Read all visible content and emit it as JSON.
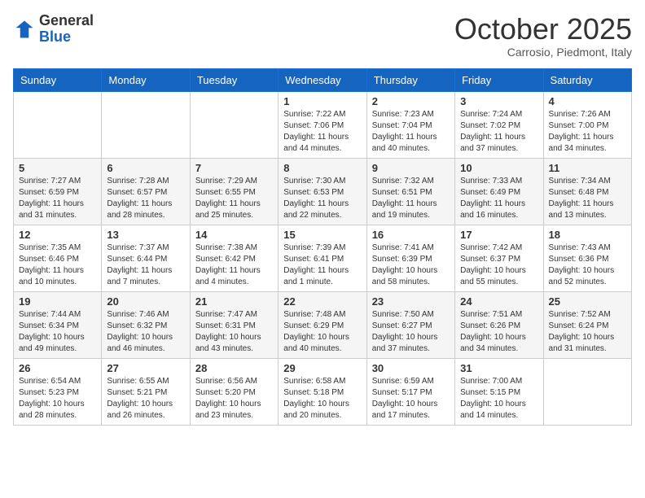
{
  "header": {
    "logo": {
      "general": "General",
      "blue": "Blue"
    },
    "title": "October 2025",
    "location": "Carrosio, Piedmont, Italy"
  },
  "weekdays": [
    "Sunday",
    "Monday",
    "Tuesday",
    "Wednesday",
    "Thursday",
    "Friday",
    "Saturday"
  ],
  "weeks": [
    [
      {
        "day": "",
        "sunrise": "",
        "sunset": "",
        "daylight": ""
      },
      {
        "day": "",
        "sunrise": "",
        "sunset": "",
        "daylight": ""
      },
      {
        "day": "",
        "sunrise": "",
        "sunset": "",
        "daylight": ""
      },
      {
        "day": "1",
        "sunrise": "Sunrise: 7:22 AM",
        "sunset": "Sunset: 7:06 PM",
        "daylight": "Daylight: 11 hours and 44 minutes."
      },
      {
        "day": "2",
        "sunrise": "Sunrise: 7:23 AM",
        "sunset": "Sunset: 7:04 PM",
        "daylight": "Daylight: 11 hours and 40 minutes."
      },
      {
        "day": "3",
        "sunrise": "Sunrise: 7:24 AM",
        "sunset": "Sunset: 7:02 PM",
        "daylight": "Daylight: 11 hours and 37 minutes."
      },
      {
        "day": "4",
        "sunrise": "Sunrise: 7:26 AM",
        "sunset": "Sunset: 7:00 PM",
        "daylight": "Daylight: 11 hours and 34 minutes."
      }
    ],
    [
      {
        "day": "5",
        "sunrise": "Sunrise: 7:27 AM",
        "sunset": "Sunset: 6:59 PM",
        "daylight": "Daylight: 11 hours and 31 minutes."
      },
      {
        "day": "6",
        "sunrise": "Sunrise: 7:28 AM",
        "sunset": "Sunset: 6:57 PM",
        "daylight": "Daylight: 11 hours and 28 minutes."
      },
      {
        "day": "7",
        "sunrise": "Sunrise: 7:29 AM",
        "sunset": "Sunset: 6:55 PM",
        "daylight": "Daylight: 11 hours and 25 minutes."
      },
      {
        "day": "8",
        "sunrise": "Sunrise: 7:30 AM",
        "sunset": "Sunset: 6:53 PM",
        "daylight": "Daylight: 11 hours and 22 minutes."
      },
      {
        "day": "9",
        "sunrise": "Sunrise: 7:32 AM",
        "sunset": "Sunset: 6:51 PM",
        "daylight": "Daylight: 11 hours and 19 minutes."
      },
      {
        "day": "10",
        "sunrise": "Sunrise: 7:33 AM",
        "sunset": "Sunset: 6:49 PM",
        "daylight": "Daylight: 11 hours and 16 minutes."
      },
      {
        "day": "11",
        "sunrise": "Sunrise: 7:34 AM",
        "sunset": "Sunset: 6:48 PM",
        "daylight": "Daylight: 11 hours and 13 minutes."
      }
    ],
    [
      {
        "day": "12",
        "sunrise": "Sunrise: 7:35 AM",
        "sunset": "Sunset: 6:46 PM",
        "daylight": "Daylight: 11 hours and 10 minutes."
      },
      {
        "day": "13",
        "sunrise": "Sunrise: 7:37 AM",
        "sunset": "Sunset: 6:44 PM",
        "daylight": "Daylight: 11 hours and 7 minutes."
      },
      {
        "day": "14",
        "sunrise": "Sunrise: 7:38 AM",
        "sunset": "Sunset: 6:42 PM",
        "daylight": "Daylight: 11 hours and 4 minutes."
      },
      {
        "day": "15",
        "sunrise": "Sunrise: 7:39 AM",
        "sunset": "Sunset: 6:41 PM",
        "daylight": "Daylight: 11 hours and 1 minute."
      },
      {
        "day": "16",
        "sunrise": "Sunrise: 7:41 AM",
        "sunset": "Sunset: 6:39 PM",
        "daylight": "Daylight: 10 hours and 58 minutes."
      },
      {
        "day": "17",
        "sunrise": "Sunrise: 7:42 AM",
        "sunset": "Sunset: 6:37 PM",
        "daylight": "Daylight: 10 hours and 55 minutes."
      },
      {
        "day": "18",
        "sunrise": "Sunrise: 7:43 AM",
        "sunset": "Sunset: 6:36 PM",
        "daylight": "Daylight: 10 hours and 52 minutes."
      }
    ],
    [
      {
        "day": "19",
        "sunrise": "Sunrise: 7:44 AM",
        "sunset": "Sunset: 6:34 PM",
        "daylight": "Daylight: 10 hours and 49 minutes."
      },
      {
        "day": "20",
        "sunrise": "Sunrise: 7:46 AM",
        "sunset": "Sunset: 6:32 PM",
        "daylight": "Daylight: 10 hours and 46 minutes."
      },
      {
        "day": "21",
        "sunrise": "Sunrise: 7:47 AM",
        "sunset": "Sunset: 6:31 PM",
        "daylight": "Daylight: 10 hours and 43 minutes."
      },
      {
        "day": "22",
        "sunrise": "Sunrise: 7:48 AM",
        "sunset": "Sunset: 6:29 PM",
        "daylight": "Daylight: 10 hours and 40 minutes."
      },
      {
        "day": "23",
        "sunrise": "Sunrise: 7:50 AM",
        "sunset": "Sunset: 6:27 PM",
        "daylight": "Daylight: 10 hours and 37 minutes."
      },
      {
        "day": "24",
        "sunrise": "Sunrise: 7:51 AM",
        "sunset": "Sunset: 6:26 PM",
        "daylight": "Daylight: 10 hours and 34 minutes."
      },
      {
        "day": "25",
        "sunrise": "Sunrise: 7:52 AM",
        "sunset": "Sunset: 6:24 PM",
        "daylight": "Daylight: 10 hours and 31 minutes."
      }
    ],
    [
      {
        "day": "26",
        "sunrise": "Sunrise: 6:54 AM",
        "sunset": "Sunset: 5:23 PM",
        "daylight": "Daylight: 10 hours and 28 minutes."
      },
      {
        "day": "27",
        "sunrise": "Sunrise: 6:55 AM",
        "sunset": "Sunset: 5:21 PM",
        "daylight": "Daylight: 10 hours and 26 minutes."
      },
      {
        "day": "28",
        "sunrise": "Sunrise: 6:56 AM",
        "sunset": "Sunset: 5:20 PM",
        "daylight": "Daylight: 10 hours and 23 minutes."
      },
      {
        "day": "29",
        "sunrise": "Sunrise: 6:58 AM",
        "sunset": "Sunset: 5:18 PM",
        "daylight": "Daylight: 10 hours and 20 minutes."
      },
      {
        "day": "30",
        "sunrise": "Sunrise: 6:59 AM",
        "sunset": "Sunset: 5:17 PM",
        "daylight": "Daylight: 10 hours and 17 minutes."
      },
      {
        "day": "31",
        "sunrise": "Sunrise: 7:00 AM",
        "sunset": "Sunset: 5:15 PM",
        "daylight": "Daylight: 10 hours and 14 minutes."
      },
      {
        "day": "",
        "sunrise": "",
        "sunset": "",
        "daylight": ""
      }
    ]
  ]
}
